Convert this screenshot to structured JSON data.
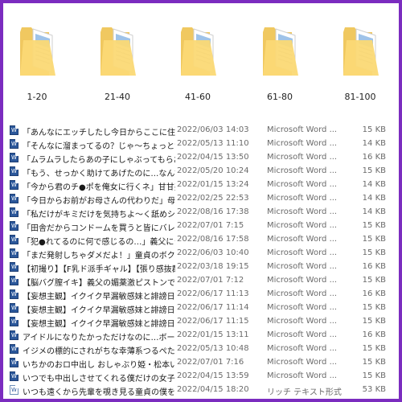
{
  "folders": [
    {
      "label": "1-20"
    },
    {
      "label": "21-40"
    },
    {
      "label": "41-60"
    },
    {
      "label": "61-80"
    },
    {
      "label": "81-100"
    }
  ],
  "files": [
    {
      "icon": "word-doc-icon",
      "name": "「あんなにエッチしたし今日からここに住むね！」...",
      "date": "2022/06/03 14:03",
      "type": "Microsoft Word ...",
      "size": "15 KB"
    },
    {
      "icon": "word-doc-icon",
      "name": "「そんなに溜まってるの？じゃ～ちょっとだけだよ」...",
      "date": "2022/05/13 11:10",
      "type": "Microsoft Word ...",
      "size": "14 KB"
    },
    {
      "icon": "word-doc-icon",
      "name": "「ムラムラしたらあの子にしゃぶってもらおうぜ」飲...",
      "date": "2022/04/15 13:50",
      "type": "Microsoft Word ...",
      "size": "16 KB"
    },
    {
      "icon": "word-doc-icon",
      "name": "「もう、せっかく助けてあげたのに…なんで？（...",
      "date": "2022/05/20 10:24",
      "type": "Microsoft Word ...",
      "size": "15 KB"
    },
    {
      "icon": "word-doc-icon",
      "name": "「今から君のチ●ポを俺女に行くネ」甘甘美...",
      "date": "2022/01/15 13:24",
      "type": "Microsoft Word ...",
      "size": "14 KB"
    },
    {
      "icon": "word-doc-icon",
      "name": "「今日からお前がお母さんの代わりだ」母が出...",
      "date": "2022/02/25 22:53",
      "type": "Microsoft Word ...",
      "size": "14 KB"
    },
    {
      "icon": "word-doc-icon",
      "name": "「私だけがキミだけを気持ちよ～く舐めシゴける」...",
      "date": "2022/08/16 17:38",
      "type": "Microsoft Word ...",
      "size": "14 KB"
    },
    {
      "icon": "word-doc-icon",
      "name": "「田舎だからコンドームを買うと皆にバレちゃう....",
      "date": "2022/07/01 7:15",
      "type": "Microsoft Word ...",
      "size": "15 KB"
    },
    {
      "icon": "word-doc-icon",
      "name": "「犯●れてるのに何で感じるの…」義父に皆●...",
      "date": "2022/08/16 17:58",
      "type": "Microsoft Word ...",
      "size": "15 KB"
    },
    {
      "icon": "word-doc-icon",
      "name": "「まだ発射しちゃダメだよ！」童貞のボクの射精...",
      "date": "2022/06/03 10:40",
      "type": "Microsoft Word ...",
      "size": "15 KB"
    },
    {
      "icon": "word-doc-icon",
      "name": "【初撮り】【F乳ド派手ギャル】【張り感抜群の...",
      "date": "2022/03/18 19:15",
      "type": "Microsoft Word ...",
      "size": "16 KB"
    },
    {
      "icon": "word-doc-icon",
      "name": "【脳バグ膣イキ】義父の媚薬激ピストンで連れ...",
      "date": "2022/07/01 7:12",
      "type": "Microsoft Word ...",
      "size": "15 KB"
    },
    {
      "icon": "word-doc-icon",
      "name": "【妄想主観】イクイク早漏敏感妹と誹謗日子...",
      "date": "2022/06/17 11:13",
      "type": "Microsoft Word ...",
      "size": "16 KB"
    },
    {
      "icon": "word-doc-icon",
      "name": "【妄想主観】イクイク早漏敏感妹と誹謗日子...",
      "date": "2022/06/17 11:14",
      "type": "Microsoft Word ...",
      "size": "15 KB"
    },
    {
      "icon": "word-doc-icon",
      "name": "【妄想主観】イクイク早漏敏感妹と誹謗日子...",
      "date": "2022/06/17 11:15",
      "type": "Microsoft Word ...",
      "size": "15 KB"
    },
    {
      "icon": "word-doc-icon",
      "name": "アイドルになりたかっただけなのに…ボーイッシュ...",
      "date": "2022/01/15 13:11",
      "type": "Microsoft Word ...",
      "size": "16 KB"
    },
    {
      "icon": "word-doc-icon",
      "name": "イジメの標的にされがちな幸薄系つるぺた地味...",
      "date": "2022/05/13 10:48",
      "type": "Microsoft Word ...",
      "size": "15 KB"
    },
    {
      "icon": "word-doc-icon",
      "name": "いちかのおロ中出し おしゃぶり姫・松本いちか...",
      "date": "2022/07/01 7:16",
      "type": "Microsoft Word ...",
      "size": "15 KB"
    },
    {
      "icon": "word-doc-icon",
      "name": "いつでも中出しさせてくれる僕だけの女子●生...",
      "date": "2022/04/15 13:59",
      "type": "Microsoft Word ...",
      "size": "15 KB"
    },
    {
      "icon": "rtf-doc-icon",
      "name": "いつも遠くから先輩を覗き見る童貞の僕を至...",
      "date": "2022/04/15 18:20",
      "type": "リッチ テキスト形式",
      "size": "53 KB"
    }
  ]
}
